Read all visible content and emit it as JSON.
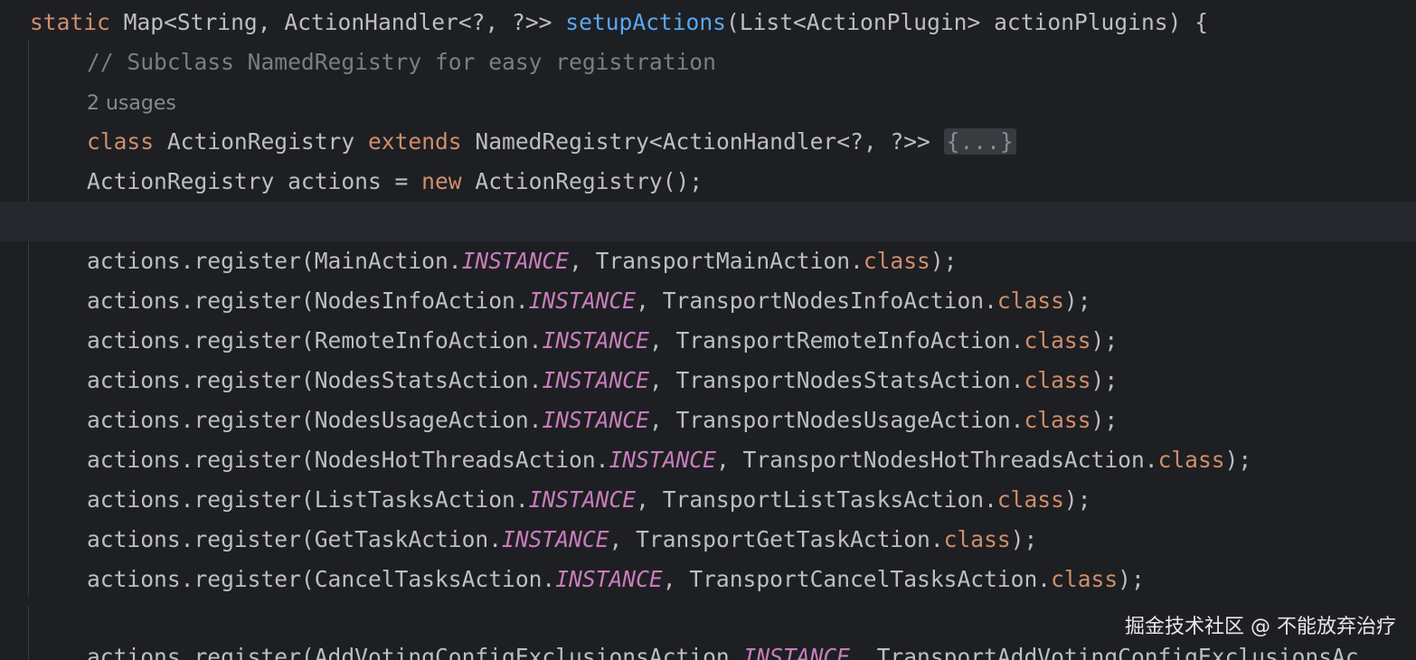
{
  "lines": {
    "l1": {
      "t1": "static",
      "t2": " Map<String, ActionHandler<?, ?>> ",
      "t3": "setupActions",
      "t4": "(List<ActionPlugin> actionPlugins) {"
    },
    "l2": {
      "t1": "// Subclass NamedRegistry for easy registration"
    },
    "l3": {
      "t1": "2 usages"
    },
    "l4": {
      "t1": "class",
      "t2": " ActionRegistry ",
      "t3": "extends",
      "t4": " NamedRegistry<ActionHandler<?, ?>> ",
      "t5": "{...}"
    },
    "l5": {
      "t1": "ActionRegistry actions = ",
      "t2": "new",
      "t3": " ActionRegistry();"
    },
    "l7": {
      "t1": "actions.register(MainAction.",
      "t2": "INSTANCE",
      "t3": ", TransportMainAction.",
      "t4": "class",
      "t5": ");"
    },
    "l8": {
      "t1": "actions.register(NodesInfoAction.",
      "t2": "INSTANCE",
      "t3": ", TransportNodesInfoAction.",
      "t4": "class",
      "t5": ");"
    },
    "l9": {
      "t1": "actions.register(RemoteInfoAction.",
      "t2": "INSTANCE",
      "t3": ", TransportRemoteInfoAction.",
      "t4": "class",
      "t5": ");"
    },
    "l10": {
      "t1": "actions.register(NodesStatsAction.",
      "t2": "INSTANCE",
      "t3": ", TransportNodesStatsAction.",
      "t4": "class",
      "t5": ");"
    },
    "l11": {
      "t1": "actions.register(NodesUsageAction.",
      "t2": "INSTANCE",
      "t3": ", TransportNodesUsageAction.",
      "t4": "class",
      "t5": ");"
    },
    "l12": {
      "t1": "actions.register(NodesHotThreadsAction.",
      "t2": "INSTANCE",
      "t3": ", TransportNodesHotThreadsAction.",
      "t4": "class",
      "t5": ");"
    },
    "l13": {
      "t1": "actions.register(ListTasksAction.",
      "t2": "INSTANCE",
      "t3": ", TransportListTasksAction.",
      "t4": "class",
      "t5": ");"
    },
    "l14": {
      "t1": "actions.register(GetTaskAction.",
      "t2": "INSTANCE",
      "t3": ", TransportGetTaskAction.",
      "t4": "class",
      "t5": ");"
    },
    "l15": {
      "t1": "actions.register(CancelTasksAction.",
      "t2": "INSTANCE",
      "t3": ", TransportCancelTasksAction.",
      "t4": "class",
      "t5": ");"
    },
    "l17": {
      "t1": "actions.register(AddVotingConfigExclusionsAction.",
      "t2": "INSTANCE",
      "t3": ", TransportAddVotingConfigExclusionsAc"
    }
  },
  "watermark": "掘金技术社区 @ 不能放弃治疗",
  "colors": {
    "background": "#1e1f22",
    "keyword": "#cf8e6d",
    "method": "#56a8f5",
    "comment": "#7a7e85",
    "static_field": "#c77dbb",
    "text": "#bcbec4"
  }
}
